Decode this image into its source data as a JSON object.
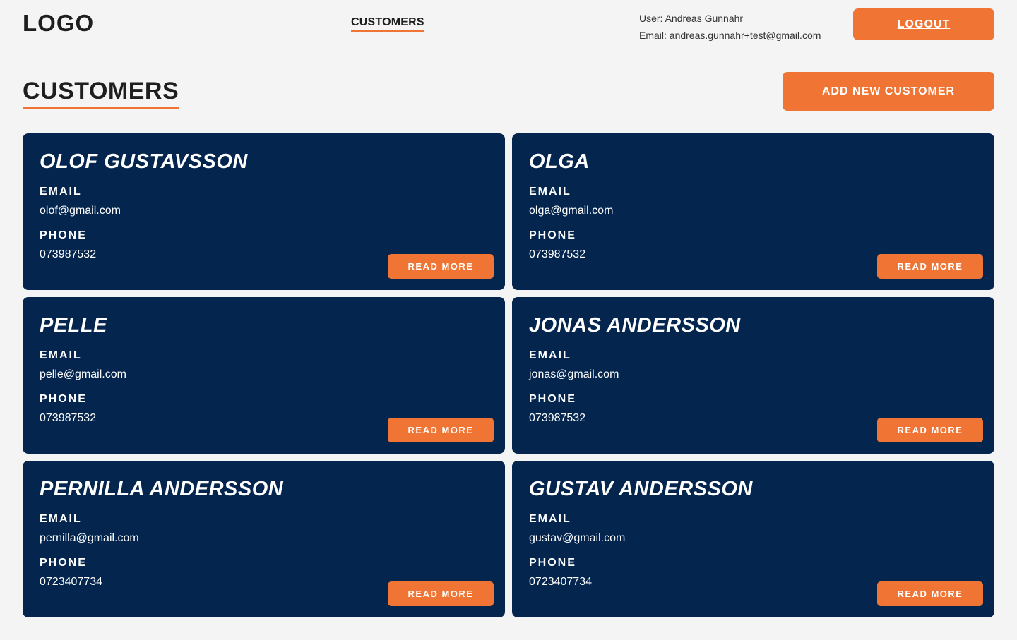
{
  "header": {
    "logo": "LOGO",
    "nav_customers": "CUSTOMERS",
    "user_line": "User: Andreas Gunnahr",
    "email_line": "Email: andreas.gunnahr+test@gmail.com",
    "logout_label": "LOGOUT"
  },
  "page": {
    "title": "CUSTOMERS",
    "add_button": "ADD NEW CUSTOMER"
  },
  "labels": {
    "email": "EMAIL",
    "phone": "PHONE",
    "read_more": "READ MORE"
  },
  "customers": [
    {
      "name": "OLOF GUSTAVSSON",
      "email": "olof@gmail.com",
      "phone": "073987532"
    },
    {
      "name": "OLGA",
      "email": "olga@gmail.com",
      "phone": "073987532"
    },
    {
      "name": "PELLE",
      "email": "pelle@gmail.com",
      "phone": "073987532"
    },
    {
      "name": "JONAS ANDERSSON",
      "email": "jonas@gmail.com",
      "phone": "073987532"
    },
    {
      "name": "PERNILLA ANDERSSON",
      "email": "pernilla@gmail.com",
      "phone": "0723407734"
    },
    {
      "name": "GUSTAV ANDERSSON",
      "email": "gustav@gmail.com",
      "phone": "0723407734"
    }
  ],
  "colors": {
    "accent": "#f07433",
    "card_background": "#03254e",
    "page_background": "#f4f4f4"
  }
}
